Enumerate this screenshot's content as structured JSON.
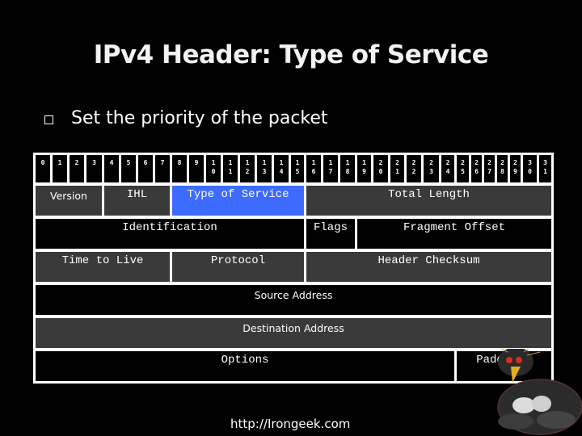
{
  "slide": {
    "title": "IPv4 Header: Type of Service",
    "bullets": [
      {
        "icon": "square-bullet-icon",
        "text": "Set the priority of the packet"
      }
    ],
    "footer_url": "http://Irongeek.com"
  },
  "header_diagram": {
    "bit_labels": [
      "0",
      "1",
      "2",
      "3",
      "4",
      "5",
      "6",
      "7",
      "8",
      "9",
      "1\n0",
      "1\n1",
      "1\n2",
      "1\n3",
      "1\n4",
      "1\n5",
      "1\n6",
      "1\n7",
      "1\n8",
      "1\n9",
      "2\n0",
      "2\n1",
      "2\n2",
      "2\n3",
      "2\n4",
      "2\n5",
      "2\n6",
      "2\n7",
      "2\n8",
      "2\n9",
      "3\n0",
      "3\n1"
    ],
    "rows": [
      [
        {
          "label": "Version",
          "bits": [
            0,
            3
          ],
          "fill": "gray",
          "font": "sans"
        },
        {
          "label": "IHL",
          "bits": [
            4,
            7
          ],
          "fill": "gray"
        },
        {
          "label": "Type of Service",
          "bits": [
            8,
            15
          ],
          "fill": "blue",
          "highlighted": true
        },
        {
          "label": "Total Length",
          "bits": [
            16,
            31
          ],
          "fill": "gray"
        }
      ],
      [
        {
          "label": "Identification",
          "bits": [
            0,
            15
          ],
          "fill": "black"
        },
        {
          "label": "Flags",
          "bits": [
            16,
            18
          ],
          "fill": "black"
        },
        {
          "label": "Fragment Offset",
          "bits": [
            19,
            31
          ],
          "fill": "black"
        }
      ],
      [
        {
          "label": "Time to Live",
          "bits": [
            0,
            7
          ],
          "fill": "gray"
        },
        {
          "label": "Protocol",
          "bits": [
            8,
            15
          ],
          "fill": "gray"
        },
        {
          "label": "Header Checksum",
          "bits": [
            16,
            31
          ],
          "fill": "gray"
        }
      ],
      [
        {
          "label": "Source Address",
          "bits": [
            0,
            31
          ],
          "fill": "black",
          "font": "sans"
        }
      ],
      [
        {
          "label": "Destination Address",
          "bits": [
            0,
            31
          ],
          "fill": "gray",
          "font": "sans"
        }
      ],
      [
        {
          "label": "Options",
          "bits": [
            0,
            24
          ],
          "fill": "black"
        },
        {
          "label": "Padding",
          "bits": [
            25,
            31
          ],
          "fill": "black",
          "align": "right"
        }
      ]
    ]
  },
  "colors": {
    "background": "#000000",
    "gray_fill": "#3a3a3a",
    "highlight_blue": "#3d6bff",
    "border": "#ffffff"
  },
  "decoration": {
    "icon": "muscular-penguin-mascot-icon"
  }
}
